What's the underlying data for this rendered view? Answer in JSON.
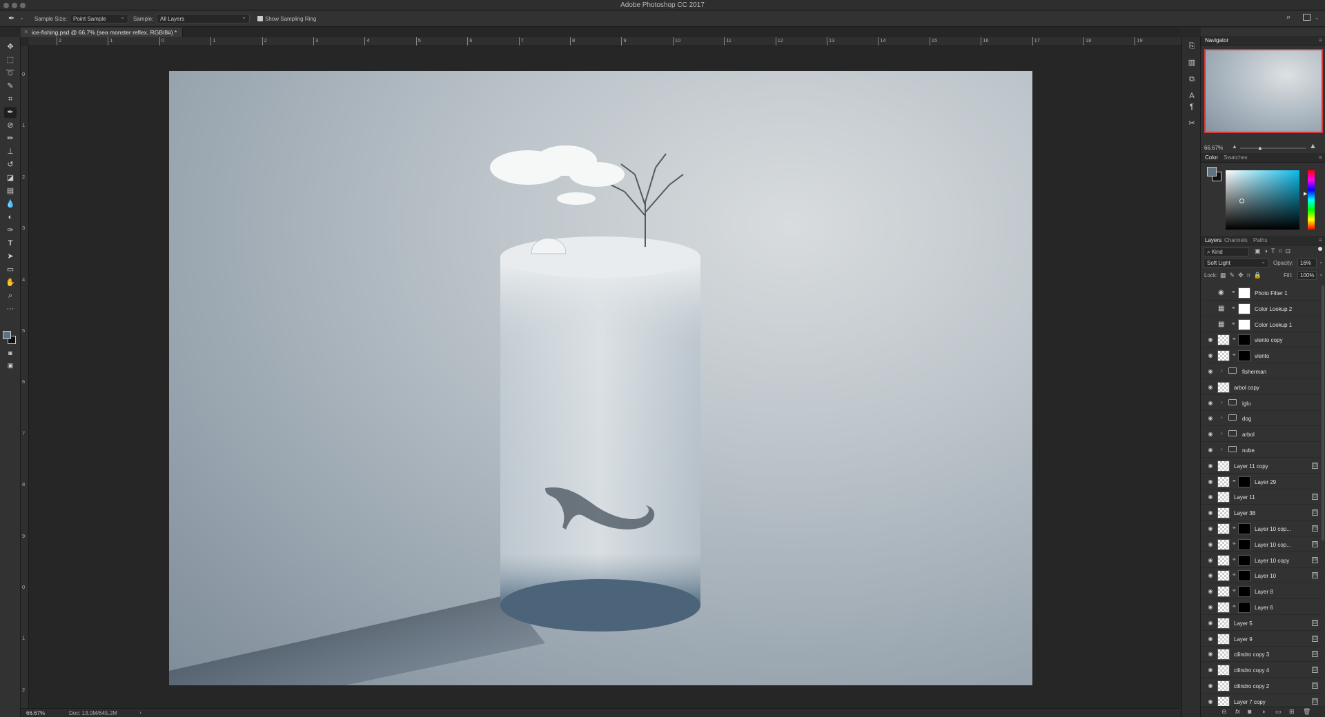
{
  "app": {
    "title": "Adobe Photoshop CC 2017"
  },
  "options_bar": {
    "sample_size_label": "Sample Size:",
    "sample_size_value": "Point Sample",
    "sample_label": "Sample:",
    "sample_value": "All Layers",
    "show_ring_label": "Show Sampling Ring"
  },
  "document": {
    "tab_title": "ice-fishing.psd @ 66.7% (sea monster reflex, RGB/8#) *"
  },
  "ruler": {
    "top_ticks": [
      "2",
      "1",
      "0",
      "1",
      "2",
      "3",
      "4",
      "5",
      "6",
      "7",
      "8",
      "9",
      "10",
      "11",
      "12",
      "13",
      "14",
      "15",
      "16",
      "17",
      "18",
      "19"
    ],
    "left_ticks": [
      "0",
      "1",
      "2",
      "3",
      "4",
      "5",
      "6",
      "7",
      "8",
      "9",
      "0",
      "1",
      "2"
    ]
  },
  "status": {
    "zoom": "66.67%",
    "doc_info": "Doc: 13.0M/645.2M"
  },
  "navigator": {
    "tab": "Navigator",
    "zoom": "66.67%"
  },
  "color_panel": {
    "tabs": [
      "Color",
      "Swatches"
    ],
    "foreground": "#5e7382",
    "background": "#111111"
  },
  "layers_panel": {
    "tabs": [
      "Layers",
      "Channels",
      "Paths"
    ],
    "filter_kind": "Kind",
    "blend_mode": "Soft Light",
    "opacity_label": "Opacity:",
    "opacity": "16%",
    "lock_label": "Lock:",
    "fill_label": "Fill:",
    "fill": "100%",
    "layers": [
      {
        "name": "Photo Filter 1",
        "type": "adjustment",
        "icon": "camera-icon",
        "visible": false
      },
      {
        "name": "Color Lookup 2",
        "type": "adjustment",
        "icon": "grid-icon",
        "visible": false
      },
      {
        "name": "Color Lookup 1",
        "type": "adjustment",
        "icon": "grid-icon",
        "visible": false
      },
      {
        "name": "viento copy",
        "type": "masked",
        "visible": true
      },
      {
        "name": "viento",
        "type": "masked",
        "visible": true
      },
      {
        "name": "fisherman",
        "type": "group",
        "visible": true
      },
      {
        "name": "arbol copy",
        "type": "layer",
        "visible": true
      },
      {
        "name": "iglu",
        "type": "group",
        "visible": true
      },
      {
        "name": "dog",
        "type": "group",
        "visible": true
      },
      {
        "name": "arbol",
        "type": "group",
        "visible": true
      },
      {
        "name": "nube",
        "type": "group",
        "visible": true
      },
      {
        "name": "Layer 11 copy",
        "type": "layer",
        "visible": true,
        "fx": true
      },
      {
        "name": "Layer 29",
        "type": "masked",
        "visible": true
      },
      {
        "name": "Layer 11",
        "type": "layer",
        "visible": true,
        "fx": true
      },
      {
        "name": "Layer 38",
        "type": "layer",
        "visible": true,
        "fx": true
      },
      {
        "name": "Layer 10 cop...",
        "type": "masked",
        "visible": true,
        "fx": true
      },
      {
        "name": "Layer 10 cop...",
        "type": "masked",
        "visible": true,
        "fx": true
      },
      {
        "name": "Layer 10 copy",
        "type": "masked",
        "visible": true,
        "fx": true
      },
      {
        "name": "Layer 10",
        "type": "masked",
        "visible": true,
        "fx": true
      },
      {
        "name": "Layer 8",
        "type": "masked",
        "visible": true
      },
      {
        "name": "Layer 6",
        "type": "masked",
        "visible": true
      },
      {
        "name": "Layer 5",
        "type": "layer",
        "visible": true,
        "fx": true
      },
      {
        "name": "Layer 9",
        "type": "layer",
        "visible": true,
        "fx": true
      },
      {
        "name": "cilindro copy 3",
        "type": "layer",
        "visible": true,
        "fx": true
      },
      {
        "name": "cilindro copy 4",
        "type": "layer",
        "visible": true,
        "fx": true
      },
      {
        "name": "cilindro copy 2",
        "type": "layer",
        "visible": true,
        "fx": true
      },
      {
        "name": "Layer 7 copy",
        "type": "layer",
        "visible": true,
        "fx": true
      }
    ]
  }
}
